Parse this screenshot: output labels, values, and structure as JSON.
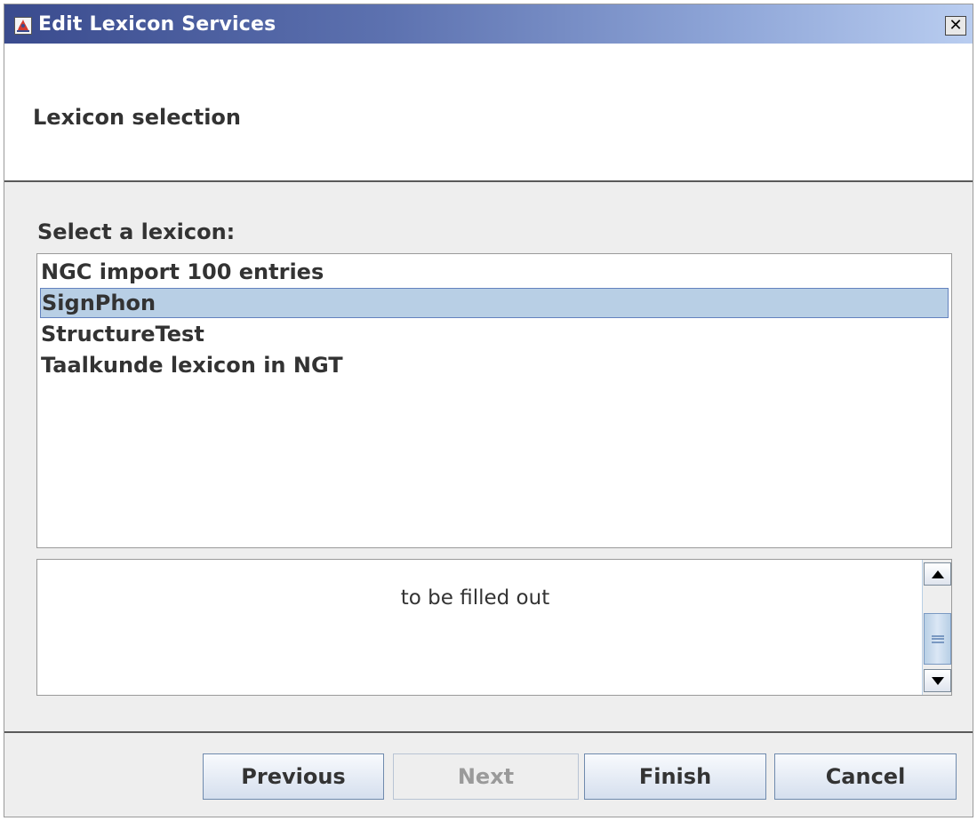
{
  "window": {
    "title": "Edit Lexicon Services",
    "close_symbol": "✕"
  },
  "header": {
    "title": "Lexicon selection"
  },
  "selection": {
    "label": "Select a lexicon:",
    "items": [
      {
        "label": "NGC import 100 entries",
        "selected": false
      },
      {
        "label": "SignPhon",
        "selected": true
      },
      {
        "label": "StructureTest",
        "selected": false
      },
      {
        "label": "Taalkunde lexicon in NGT",
        "selected": false
      }
    ]
  },
  "description": {
    "text": "to be filled out"
  },
  "buttons": {
    "previous": "Previous",
    "next": "Next",
    "next_enabled": false,
    "finish": "Finish",
    "cancel": "Cancel"
  },
  "colors": {
    "title_gradient_start": "#3a4b8e",
    "title_gradient_end": "#b9cdf0",
    "selection_bg": "#b8cfe5",
    "selection_border": "#6382be"
  }
}
